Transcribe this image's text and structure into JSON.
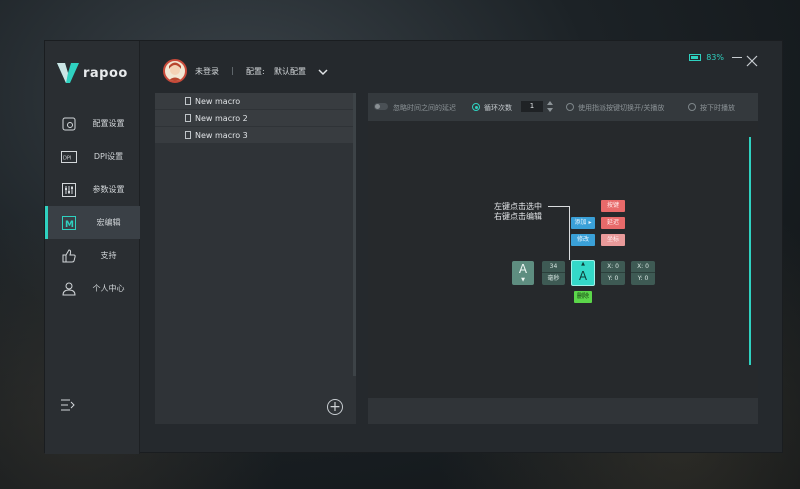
{
  "app": {
    "brand": "rapoo",
    "accent": "#2fd1c0"
  },
  "topbar": {
    "login": "未登录",
    "separator": "|",
    "config_label": "配置:",
    "config_value": "默认配置",
    "battery_pct": "83%",
    "battery_level": 0.83
  },
  "sidebar": {
    "items": [
      {
        "label": "配置设置",
        "icon": "config-icon"
      },
      {
        "label": "DPI设置",
        "icon": "dpi-icon"
      },
      {
        "label": "参数设置",
        "icon": "params-icon"
      },
      {
        "label": "宏编辑",
        "icon": "macro-icon",
        "active": true
      },
      {
        "label": "支持",
        "icon": "thumbs-up-icon"
      },
      {
        "label": "个人中心",
        "icon": "user-icon"
      }
    ]
  },
  "macros": {
    "items": [
      {
        "label": "New macro"
      },
      {
        "label": "New macro 2"
      },
      {
        "label": "New macro 3"
      }
    ],
    "add_symbol": "+"
  },
  "editor": {
    "options": {
      "ignore_delay": "忽略时间之间的延迟",
      "loop_count_label": "循环次数",
      "loop_count": "1",
      "toggle_play": "使用指派按键切换开/关播放",
      "hold_play": "按下时播放"
    },
    "hint_line1": "左键点击选中",
    "hint_line2": "右键点击编辑",
    "tags": {
      "add": "添加 ▸",
      "edit": "修改",
      "key": "按键",
      "delay": "延迟",
      "coord": "坐标",
      "delete": "删除"
    },
    "keys": {
      "a1": "A",
      "a1_arrow": "▼",
      "delay_value": "34",
      "delay_unit": "毫秒",
      "a2": "A",
      "a2_arrow": "▲",
      "coord1_x": "X: 0",
      "coord1_y": "Y: 0",
      "coord2_x": "X: 0",
      "coord2_y": "Y: 0"
    }
  }
}
